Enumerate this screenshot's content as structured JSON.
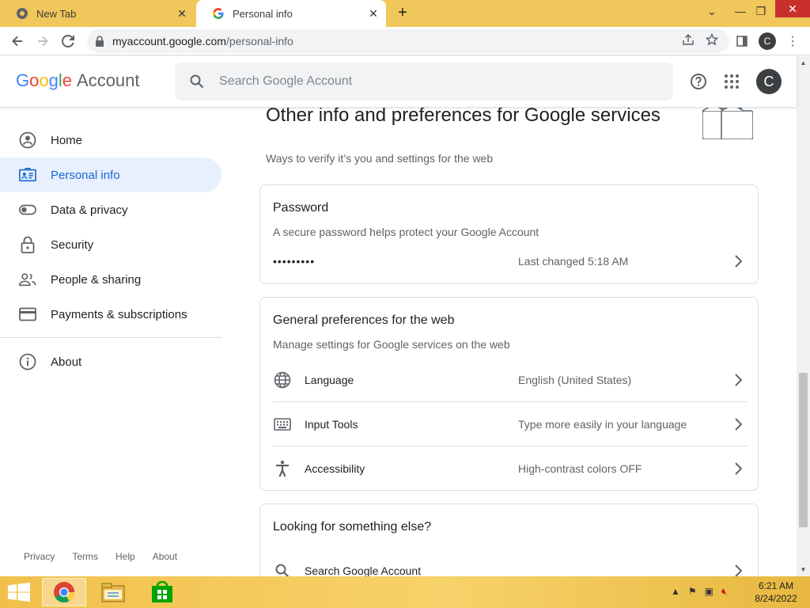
{
  "browser": {
    "tabs": [
      {
        "title": "New Tab",
        "active": false
      },
      {
        "title": "Personal info",
        "active": true
      }
    ],
    "url_host": "myaccount.google.com",
    "url_path": "/personal-info",
    "profile_initial": "C"
  },
  "header": {
    "logo_letters": [
      "G",
      "o",
      "o",
      "g",
      "l",
      "e"
    ],
    "logo_suffix": "Account",
    "search_placeholder": "Search Google Account",
    "avatar_initial": "C"
  },
  "sidebar": {
    "items": [
      {
        "label": "Home",
        "icon": "account-circle-icon",
        "active": false
      },
      {
        "label": "Personal info",
        "icon": "id-card-icon",
        "active": true
      },
      {
        "label": "Data & privacy",
        "icon": "toggle-icon",
        "active": false
      },
      {
        "label": "Security",
        "icon": "lock-icon",
        "active": false
      },
      {
        "label": "People & sharing",
        "icon": "people-icon",
        "active": false
      },
      {
        "label": "Payments & subscriptions",
        "icon": "credit-card-icon",
        "active": false
      },
      {
        "label": "About",
        "icon": "info-icon",
        "active": false
      }
    ],
    "footer": [
      "Privacy",
      "Terms",
      "Help",
      "About"
    ]
  },
  "main": {
    "section_title": "Other info and preferences for Google services",
    "section_subtitle": "Ways to verify it’s you and settings for the web",
    "password_card": {
      "title": "Password",
      "description": "A secure password helps protect your Google Account",
      "masked": "•••••••••",
      "last_changed": "Last changed 5:18 AM"
    },
    "prefs_card": {
      "title": "General preferences for the web",
      "description": "Manage settings for Google services on the web",
      "rows": [
        {
          "label": "Language",
          "value": "English (United States)",
          "icon": "globe-icon"
        },
        {
          "label": "Input Tools",
          "value": "Type more easily in your language",
          "icon": "keyboard-icon"
        },
        {
          "label": "Accessibility",
          "value": "High-contrast colors OFF",
          "icon": "accessibility-icon"
        }
      ]
    },
    "else_card": {
      "title": "Looking for something else?",
      "row_label": "Search Google Account"
    }
  },
  "taskbar": {
    "time": "6:21 AM",
    "date": "8/24/2022"
  },
  "colors": {
    "accent": "#1967d2",
    "active_bg": "#e8f0fe",
    "taskbar": "#f2c04a"
  }
}
